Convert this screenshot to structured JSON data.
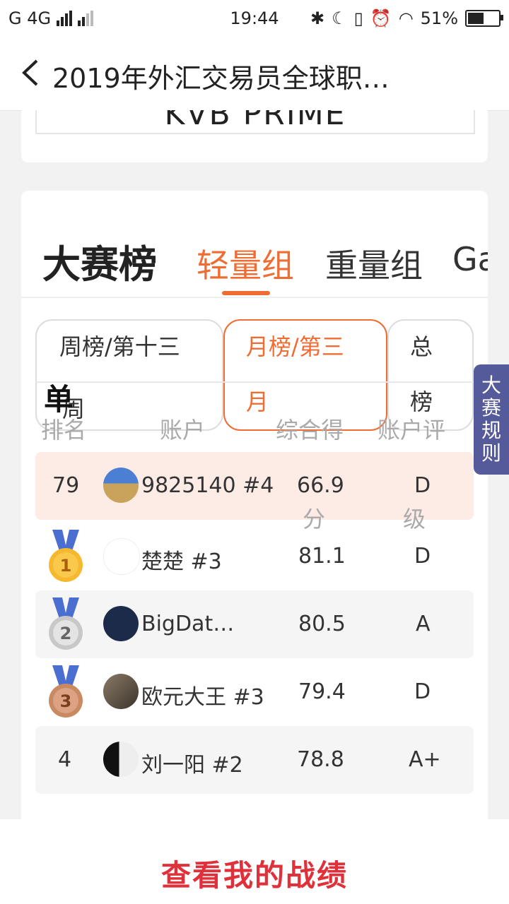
{
  "status": {
    "left": "G 4G",
    "time": "19:44",
    "battery": "51%"
  },
  "header": {
    "title": "2019年外汇交易员全球职…"
  },
  "banner": {
    "logo_text": "KVB PRIME"
  },
  "board": {
    "title": "大赛榜",
    "tabs": [
      "轻量组",
      "重量组",
      "Ga"
    ],
    "active_tab": "轻量组",
    "periods": [
      "周榜/第十三",
      "月榜/第三",
      "总",
      "周",
      "月",
      "榜"
    ],
    "rank_title": "单",
    "columns": [
      "排名",
      "账户",
      "综合得",
      "账户评",
      "分",
      "级"
    ]
  },
  "rows": [
    {
      "rank": "79",
      "name": "9825140 #4",
      "score": "66.9",
      "grade": "D"
    },
    {
      "rank": "1",
      "name": "楚楚 #3",
      "score": "81.1",
      "grade": "D"
    },
    {
      "rank": "2",
      "name": "BigDat…",
      "score": "80.5",
      "grade": "A"
    },
    {
      "rank": "3",
      "name": "欧元大王 #3",
      "score": "79.4",
      "grade": "D"
    },
    {
      "rank": "4",
      "name": "刘一阳 #2",
      "score": "78.8",
      "grade": "A+"
    }
  ],
  "side_button": "大赛规则",
  "footer_button": "查看我的战绩",
  "colors": {
    "accent": "#ef6c33",
    "footer": "#e0313b",
    "side": "#555a9a"
  }
}
